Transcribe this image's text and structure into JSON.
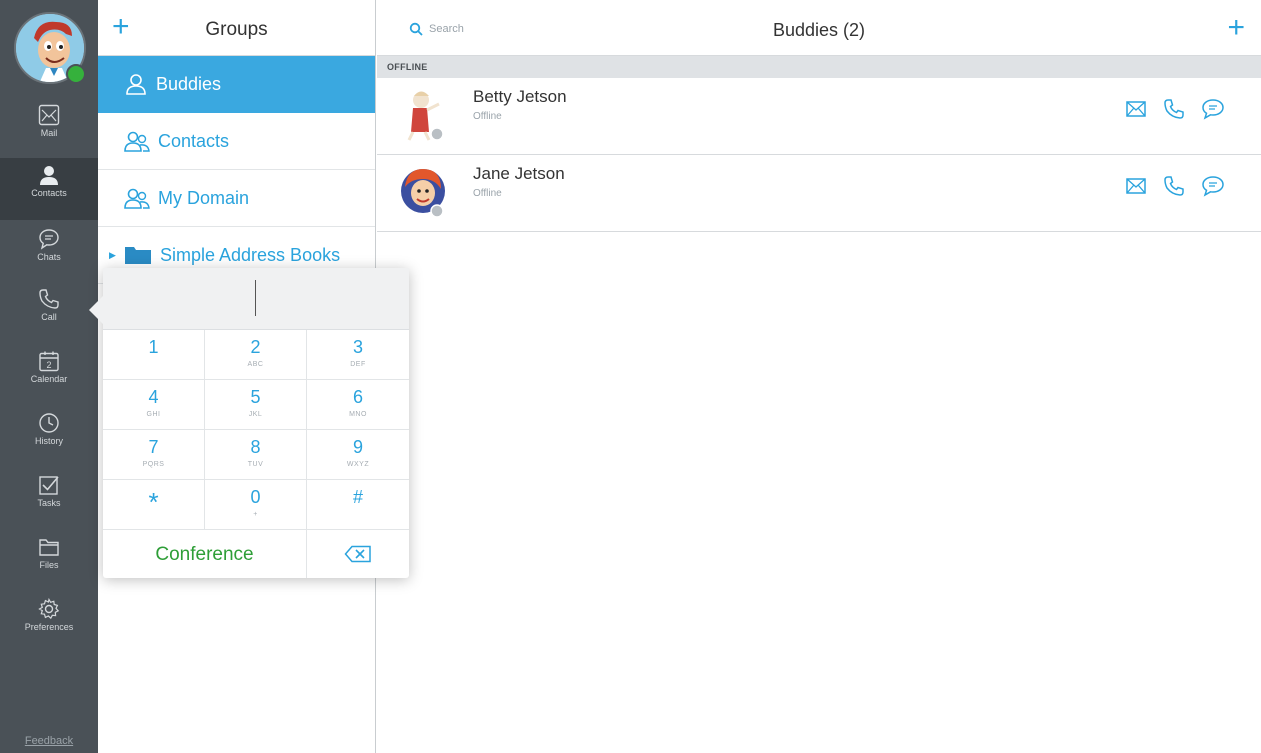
{
  "rail": {
    "items": [
      {
        "label": "Mail",
        "icon": "mail-icon"
      },
      {
        "label": "Contacts",
        "icon": "person-icon"
      },
      {
        "label": "Chats",
        "icon": "chat-bubble-icon"
      },
      {
        "label": "Call",
        "icon": "phone-icon"
      },
      {
        "label": "Calendar",
        "icon": "calendar-icon",
        "day": "2"
      },
      {
        "label": "History",
        "icon": "clock-icon"
      },
      {
        "label": "Tasks",
        "icon": "checkbox-icon"
      },
      {
        "label": "Files",
        "icon": "folder-icon"
      },
      {
        "label": "Preferences",
        "icon": "gear-icon"
      }
    ],
    "active": "Contacts",
    "feedback": "Feedback"
  },
  "groups": {
    "title": "Groups",
    "items": [
      {
        "label": "Buddies"
      },
      {
        "label": "Contacts"
      },
      {
        "label": "My Domain"
      },
      {
        "label": "Simple Address Books"
      }
    ]
  },
  "main": {
    "search_placeholder": "Search",
    "title": "Buddies (2)",
    "section": "OFFLINE",
    "buddies": [
      {
        "name": "Betty Jetson",
        "status": "Offline"
      },
      {
        "name": "Jane Jetson",
        "status": "Offline"
      }
    ]
  },
  "dialpad": {
    "keys": [
      {
        "digit": "1",
        "letters": ""
      },
      {
        "digit": "2",
        "letters": "ABC"
      },
      {
        "digit": "3",
        "letters": "DEF"
      },
      {
        "digit": "4",
        "letters": "GHI"
      },
      {
        "digit": "5",
        "letters": "JKL"
      },
      {
        "digit": "6",
        "letters": "MNO"
      },
      {
        "digit": "7",
        "letters": "PQRS"
      },
      {
        "digit": "8",
        "letters": "TUV"
      },
      {
        "digit": "9",
        "letters": "WXYZ"
      },
      {
        "digit": "*",
        "letters": ""
      },
      {
        "digit": "0",
        "letters": "+"
      },
      {
        "digit": "#",
        "letters": ""
      }
    ],
    "conference": "Conference"
  },
  "colors": {
    "accent": "#2aa3dd",
    "selected": "#3aa8e0",
    "rail": "#4a5157",
    "presence": "#35b13c",
    "conference": "#2e9e37"
  }
}
